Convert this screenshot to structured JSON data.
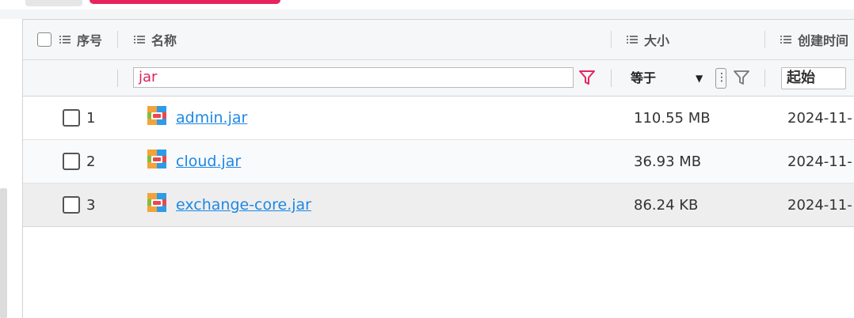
{
  "table": {
    "header": {
      "seq": "序号",
      "name": "名称",
      "size": "大小",
      "created": "创建时间"
    },
    "filter": {
      "name_value": "jar",
      "size_operator": "等于",
      "size_operator_toggle": "⋮",
      "date_start_placeholder": "起始"
    },
    "rows": [
      {
        "seq": "1",
        "name": "admin.jar",
        "size": "110.55 MB",
        "created": "2024-11-"
      },
      {
        "seq": "2",
        "name": "cloud.jar",
        "size": "36.93 MB",
        "created": "2024-11-"
      },
      {
        "seq": "3",
        "name": "exchange-core.jar",
        "size": "86.24 KB",
        "created": "2024-11-"
      }
    ]
  },
  "icons": {
    "header_col": "list-icon",
    "filter": "funnel-icon",
    "file": "archive-zip-icon"
  },
  "colors": {
    "accent": "#e8245e",
    "filter_active": "#e8245e",
    "link": "#1e88e5",
    "selected_row": "#eeeeee"
  }
}
